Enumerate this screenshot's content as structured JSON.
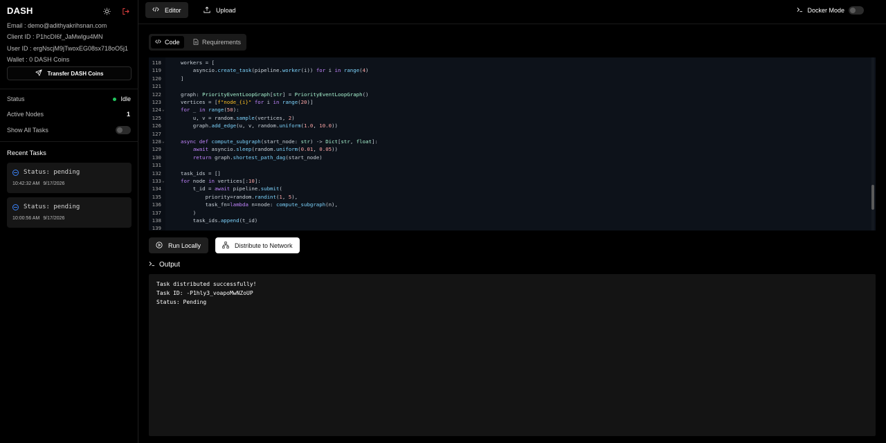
{
  "sidebar": {
    "brand": "DASH",
    "email": "Email : demo@adithyakrihsnan.com",
    "client_id": "Client ID : P1hcDI6f_JaMwlgu4MN",
    "user_id": "User ID : ergNscjM9jTwoxEG08sx718oO5j1",
    "wallet": "Wallet : 0 DASH Coins",
    "transfer_label": "Transfer DASH Coins",
    "status_label": "Status",
    "status_value": "Idle",
    "active_nodes_label": "Active Nodes",
    "active_nodes_value": "1",
    "show_all_tasks_label": "Show All Tasks",
    "recent_tasks_title": "Recent Tasks",
    "tasks": [
      {
        "status": "Status: pending",
        "time": "10:42:32 AM",
        "date": "9/17/2026"
      },
      {
        "status": "Status: pending",
        "time": "10:00:56 AM",
        "date": "9/17/2026"
      }
    ]
  },
  "header": {
    "editor_label": "Editor",
    "upload_label": "Upload",
    "docker_label": "Docker Mode"
  },
  "editor": {
    "code_tab": "Code",
    "requirements_tab": "Requirements",
    "lines": [
      {
        "n": "118",
        "fold": "",
        "code": "workers = ["
      },
      {
        "n": "119",
        "fold": "",
        "code": "    asyncio.create_task(pipeline.worker(i)) for i in range(4)"
      },
      {
        "n": "120",
        "fold": "",
        "code": "]"
      },
      {
        "n": "121",
        "fold": "",
        "code": ""
      },
      {
        "n": "122",
        "fold": "",
        "code": "graph: PriorityEventLoopGraph[str] = PriorityEventLoopGraph()"
      },
      {
        "n": "123",
        "fold": "",
        "code": "vertices = [f\"node_{i}\" for i in range(20)]"
      },
      {
        "n": "124",
        "fold": "⌄",
        "code": "for _ in range(50):"
      },
      {
        "n": "125",
        "fold": "",
        "code": "    u, v = random.sample(vertices, 2)"
      },
      {
        "n": "126",
        "fold": "",
        "code": "    graph.add_edge(u, v, random.uniform(1.0, 10.0))"
      },
      {
        "n": "127",
        "fold": "",
        "code": ""
      },
      {
        "n": "128",
        "fold": "⌄",
        "code": "async def compute_subgraph(start_node: str) -> Dict[str, float]:"
      },
      {
        "n": "129",
        "fold": "",
        "code": "    await asyncio.sleep(random.uniform(0.01, 0.05))"
      },
      {
        "n": "130",
        "fold": "",
        "code": "    return graph.shortest_path_dag(start_node)"
      },
      {
        "n": "131",
        "fold": "",
        "code": ""
      },
      {
        "n": "132",
        "fold": "",
        "code": "task_ids = []"
      },
      {
        "n": "133",
        "fold": "⌄",
        "code": "for node in vertices[:10]:"
      },
      {
        "n": "134",
        "fold": "",
        "code": "    t_id = await pipeline.submit("
      },
      {
        "n": "135",
        "fold": "",
        "code": "        priority=random.randint(1, 5),"
      },
      {
        "n": "136",
        "fold": "",
        "code": "        task_fn=lambda n=node: compute_subgraph(n),"
      },
      {
        "n": "137",
        "fold": "",
        "code": "    )"
      },
      {
        "n": "138",
        "fold": "",
        "code": "    task_ids.append(t_id)"
      },
      {
        "n": "139",
        "fold": "",
        "code": ""
      }
    ]
  },
  "actions": {
    "run_label": "Run Locally",
    "distribute_label": "Distribute to Network"
  },
  "output": {
    "title": "Output",
    "lines": [
      "Task distributed successfully!",
      "Task ID: -P1hly3_voapoMwNZoUP",
      "Status: Pending"
    ]
  },
  "colors": {
    "status_dot": "#22c55e",
    "pending_icon": "#3b82f6",
    "logout_icon": "#ef4444"
  }
}
